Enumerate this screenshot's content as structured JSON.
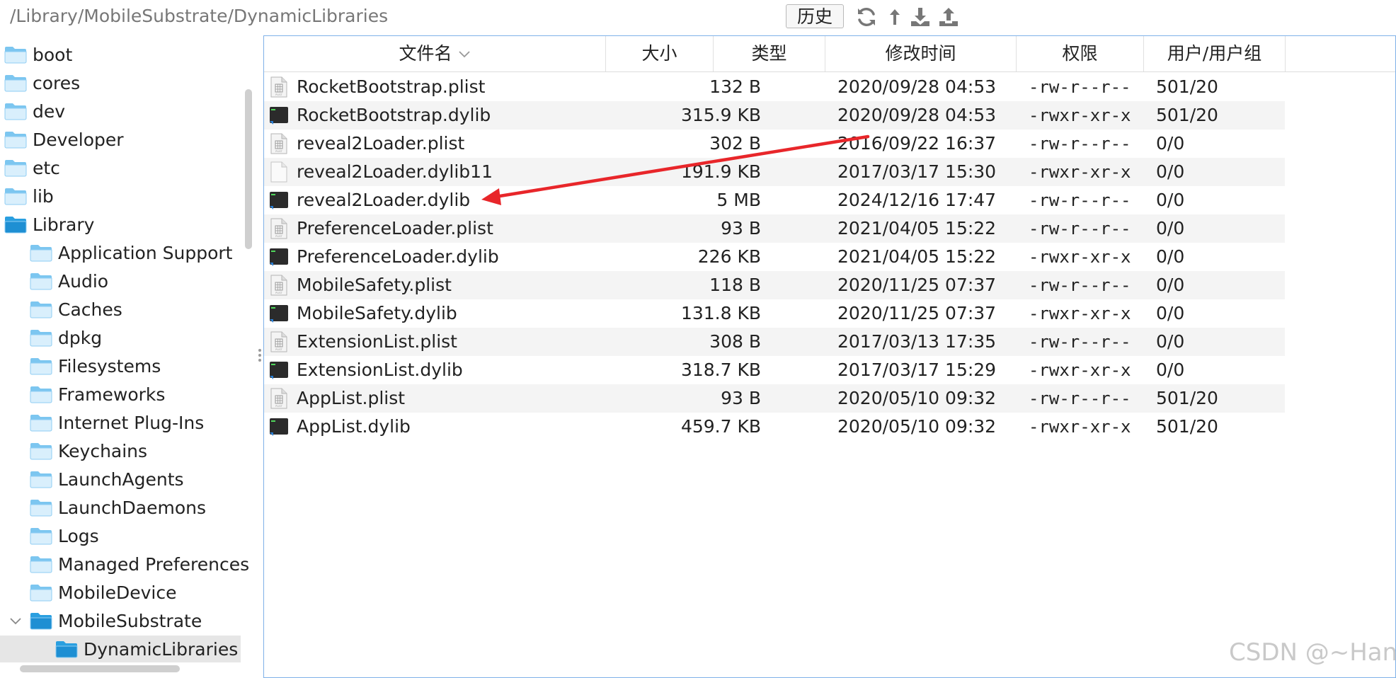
{
  "toolbar": {
    "path": "/Library/MobileSubstrate/DynamicLibraries",
    "history_label": "历史",
    "icons": [
      "refresh-icon",
      "up-icon",
      "download-icon",
      "upload-icon"
    ]
  },
  "sidebar": {
    "items": [
      {
        "label": "boot",
        "level": 0,
        "selected": false
      },
      {
        "label": "cores",
        "level": 0,
        "selected": false
      },
      {
        "label": "dev",
        "level": 0,
        "selected": false
      },
      {
        "label": "Developer",
        "level": 0,
        "selected": false
      },
      {
        "label": "etc",
        "level": 0,
        "selected": false
      },
      {
        "label": "lib",
        "level": 0,
        "selected": false
      },
      {
        "label": "Library",
        "level": 0,
        "selected": false,
        "expanded": true
      },
      {
        "label": "Application Support",
        "level": 1,
        "selected": false
      },
      {
        "label": "Audio",
        "level": 1,
        "selected": false
      },
      {
        "label": "Caches",
        "level": 1,
        "selected": false
      },
      {
        "label": "dpkg",
        "level": 1,
        "selected": false
      },
      {
        "label": "Filesystems",
        "level": 1,
        "selected": false
      },
      {
        "label": "Frameworks",
        "level": 1,
        "selected": false
      },
      {
        "label": "Internet Plug-Ins",
        "level": 1,
        "selected": false
      },
      {
        "label": "Keychains",
        "level": 1,
        "selected": false
      },
      {
        "label": "LaunchAgents",
        "level": 1,
        "selected": false
      },
      {
        "label": "LaunchDaemons",
        "level": 1,
        "selected": false
      },
      {
        "label": "Logs",
        "level": 1,
        "selected": false
      },
      {
        "label": "Managed Preferences",
        "level": 1,
        "selected": false
      },
      {
        "label": "MobileDevice",
        "level": 1,
        "selected": false
      },
      {
        "label": "MobileSubstrate",
        "level": 1,
        "selected": false,
        "expanded": true
      },
      {
        "label": "DynamicLibraries",
        "level": 2,
        "selected": true
      }
    ]
  },
  "table": {
    "columns": [
      "文件名",
      "大小",
      "类型",
      "修改时间",
      "权限",
      "用户/用户组"
    ],
    "rows": [
      {
        "name": "RocketBootstrap.plist",
        "icon": "plist-file-icon",
        "size": "132 B",
        "type": "",
        "modified": "2020/09/28 04:53",
        "permissions": "-rw-r--r--",
        "owner": "501/20"
      },
      {
        "name": "RocketBootstrap.dylib",
        "icon": "executable-file-icon",
        "size": "315.9 KB",
        "type": "",
        "modified": "2020/09/28 04:53",
        "permissions": "-rwxr-xr-x",
        "owner": "501/20"
      },
      {
        "name": "reveal2Loader.plist",
        "icon": "plist-file-icon",
        "size": "302 B",
        "type": "",
        "modified": "2016/09/22 16:37",
        "permissions": "-rw-r--r--",
        "owner": "0/0"
      },
      {
        "name": "reveal2Loader.dylib11",
        "icon": "generic-file-icon",
        "size": "191.9 KB",
        "type": "",
        "modified": "2017/03/17 15:30",
        "permissions": "-rwxr-xr-x",
        "owner": "0/0"
      },
      {
        "name": "reveal2Loader.dylib",
        "icon": "executable-file-icon",
        "size": "5 MB",
        "type": "",
        "modified": "2024/12/16 17:47",
        "permissions": "-rw-r--r--",
        "owner": "0/0"
      },
      {
        "name": "PreferenceLoader.plist",
        "icon": "plist-file-icon",
        "size": "93 B",
        "type": "",
        "modified": "2021/04/05 15:22",
        "permissions": "-rw-r--r--",
        "owner": "0/0"
      },
      {
        "name": "PreferenceLoader.dylib",
        "icon": "executable-file-icon",
        "size": "226 KB",
        "type": "",
        "modified": "2021/04/05 15:22",
        "permissions": "-rwxr-xr-x",
        "owner": "0/0"
      },
      {
        "name": "MobileSafety.plist",
        "icon": "plist-file-icon",
        "size": "118 B",
        "type": "",
        "modified": "2020/11/25 07:37",
        "permissions": "-rw-r--r--",
        "owner": "0/0"
      },
      {
        "name": "MobileSafety.dylib",
        "icon": "executable-file-icon",
        "size": "131.8 KB",
        "type": "",
        "modified": "2020/11/25 07:37",
        "permissions": "-rwxr-xr-x",
        "owner": "0/0"
      },
      {
        "name": "ExtensionList.plist",
        "icon": "plist-file-icon",
        "size": "308 B",
        "type": "",
        "modified": "2017/03/13 17:35",
        "permissions": "-rw-r--r--",
        "owner": "0/0"
      },
      {
        "name": "ExtensionList.dylib",
        "icon": "executable-file-icon",
        "size": "318.7 KB",
        "type": "",
        "modified": "2017/03/17 15:29",
        "permissions": "-rwxr-xr-x",
        "owner": "0/0"
      },
      {
        "name": "AppList.plist",
        "icon": "plist-file-icon",
        "size": "93 B",
        "type": "",
        "modified": "2020/05/10 09:32",
        "permissions": "-rw-r--r--",
        "owner": "501/20"
      },
      {
        "name": "AppList.dylib",
        "icon": "executable-file-icon",
        "size": "459.7 KB",
        "type": "",
        "modified": "2020/05/10 09:32",
        "permissions": "-rwxr-xr-x",
        "owner": "501/20"
      }
    ]
  },
  "annotation": {
    "color": "#e8262a"
  },
  "colors": {
    "folder": "#5fb8ec",
    "selected_bg": "#e6e6e6",
    "pane_border": "#7fb1e8"
  },
  "watermark": "CSDN @~Han"
}
